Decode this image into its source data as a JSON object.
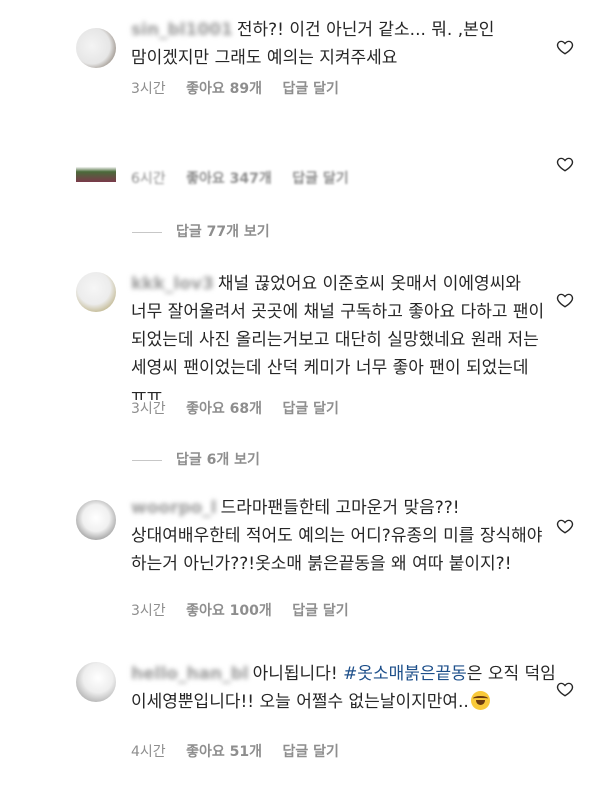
{
  "comments": [
    {
      "username": "sin_bl1001",
      "text": "전하?! 이건 아닌거 같소... 뭐. ,본인 맘이겠지만 그래도 예의는 지켜주세요",
      "time": "3시간",
      "likes": "좋아요 89개",
      "reply": "답글 달기"
    },
    {
      "username": "",
      "text": "",
      "time": "6시간",
      "likes": "좋아요 347개",
      "reply": "답글 달기",
      "view_replies": "답글 77개 보기"
    },
    {
      "username": "kkk_lov3",
      "text": "채널 끊었어요 이준호씨 옷매서 이에영씨와 너무 잘어울려서 곳곳에 채널 구독하고 좋아요 다하고 팬이 되었는데 사진 올리는거보고 대단히 실망했네요 원래 저는 세영씨 팬이었는데 산덕 케미가 너무 좋아 팬이 되었는데 ㅠㅠ",
      "time": "3시간",
      "likes": "좋아요 68개",
      "reply": "답글 달기",
      "view_replies": "답글 6개 보기"
    },
    {
      "username": "woorpo_l",
      "text": "드라마팬들한테 고마운거 맞음??!상대여배우한테 적어도 예의는 어디?유종의 미를 장식해야 하는거 아닌가??!옷소매 붉은끝동을 왜 여따 붙이지?!",
      "time": "3시간",
      "likes": "좋아요 100개",
      "reply": "답글 달기"
    },
    {
      "username": "hello_han_bl",
      "text_before": "아니됩니다!",
      "hashtag": "#옷소매붉은끝동",
      "text_after": "은 오직 덕임 이세영뿐입니다!! 오늘 어쩔수 없는날이지만여..",
      "time": "4시간",
      "likes": "좋아요 51개",
      "reply": "답글 달기"
    }
  ]
}
